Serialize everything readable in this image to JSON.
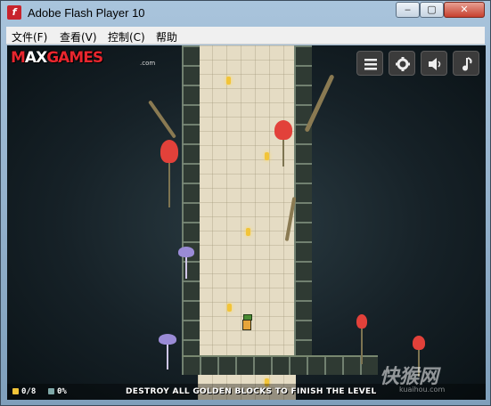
{
  "window": {
    "title": "Adobe Flash Player 10",
    "app_icon_glyph": "f",
    "controls": {
      "minimize": "‒",
      "maximize": "▢",
      "close": "✕"
    }
  },
  "menubar": {
    "items": [
      "文件(F)",
      "查看(V)",
      "控制(C)",
      "帮助"
    ]
  },
  "game": {
    "logo": {
      "part1": "M",
      "part2": "AX",
      "part3": "GAMES",
      "dotcom": ".com"
    },
    "hud_buttons": [
      {
        "name": "menu-icon",
        "label": "menu"
      },
      {
        "name": "gear-icon",
        "label": "settings"
      },
      {
        "name": "speaker-icon",
        "label": "sound"
      },
      {
        "name": "music-icon",
        "label": "music"
      }
    ],
    "gold_counter": "0/8",
    "stone_counter": "0%",
    "hint": "DESTROY ALL GOLDEN BLOCKS TO FINISH THE LEVEL",
    "colors": {
      "gold": "#f2c438",
      "mushroom_red": "#e2413a",
      "mushroom_purple": "#9a8bd6",
      "shaft": "#e5dcc4"
    }
  },
  "watermark": {
    "text": "快猴网",
    "sub": "kuaihou.com"
  }
}
